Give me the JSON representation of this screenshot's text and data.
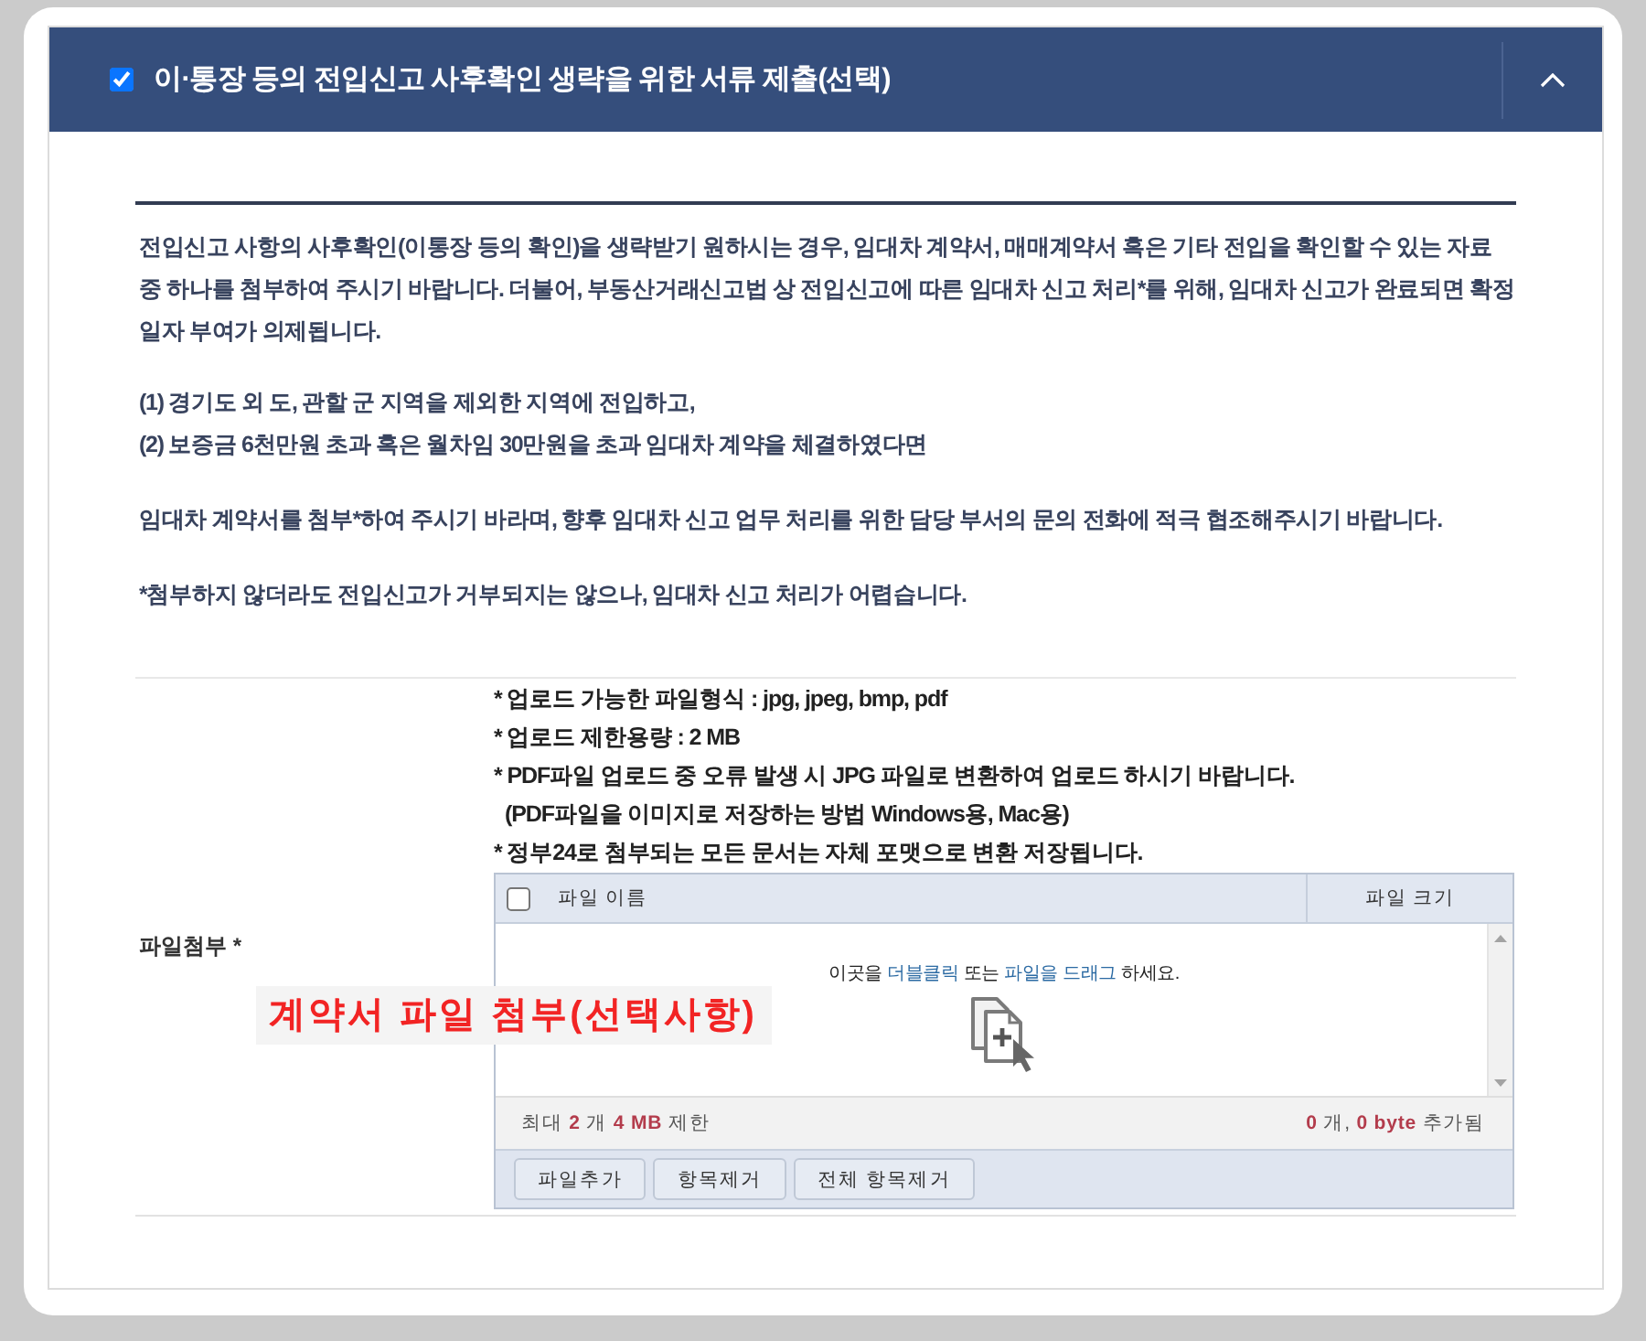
{
  "section": {
    "title": "이·통장 등의 전입신고 사후확인 생략을 위한 서류 제출(선택)",
    "checked": true,
    "expanded": true
  },
  "notice": {
    "paragraphs": [
      {
        "lines": [
          "전입신고 사항의 사후확인(이통장 등의 확인)을 생략받기 원하시는 경우, 임대차 계약서, 매매계약서 혹은 기타 전입을 확인할 수 있는 자료 중 하나를 첨부하여 주시기 바랍니다. 더불어, 부동산거래신고법 상 전입신고에 따른 임대차 신고 처리*를 위해, 임대차 신고가 완료되면 확정일자 부여가 의제됩니다."
        ]
      },
      {
        "lines": [
          "(1) 경기도 외 도, 관할 군 지역을 제외한 지역에 전입하고,",
          "(2) 보증금 6천만원 초과 혹은 월차임 30만원을 초과 임대차 계약을 체결하였다면"
        ]
      },
      {
        "lines": [
          "임대차 계약서를 첨부*하여 주시기 바라며, 향후 임대차 신고 업무 처리를 위한 담당 부서의 문의 전화에 적극 협조해주시기 바랍니다."
        ]
      },
      {
        "lines": [
          "*첨부하지 않더라도 전입신고가 거부되지는 않으나, 임대차 신고 처리가 어렵습니다."
        ]
      }
    ]
  },
  "attachment": {
    "label": "파일첨부 *",
    "notes": [
      {
        "text": "* 업로드 가능한 파일형식 : jpg, jpeg, bmp, pdf",
        "kind": "bullet"
      },
      {
        "text": "* 업로드 제한용량 : 2 MB",
        "kind": "bullet"
      },
      {
        "text": "* PDF파일 업로드 중 오류 발생 시 JPG 파일로 변환하여 업로드 하시기 바랍니다.",
        "kind": "bullet"
      },
      {
        "text": "(PDF파일을 이미지로 저장하는 방법  Windows용, Mac용)",
        "kind": "sub"
      },
      {
        "text": "* 정부24로 첨부되는 모든 문서는 자체 포맷으로 변환 저장됩니다.",
        "kind": "bullet"
      }
    ],
    "uploader": {
      "select_all_checked": false,
      "columns": [
        "파일 이름",
        "파일 크기"
      ],
      "drop_hint": [
        {
          "text": "이곳을 ",
          "kind": "plain"
        },
        {
          "text": "더블클릭",
          "kind": "accent"
        },
        {
          "text": " 또는 ",
          "kind": "plain"
        },
        {
          "text": "파일을 드래그",
          "kind": "accent"
        },
        {
          "text": " 하세요.",
          "kind": "plain"
        }
      ],
      "limit": [
        {
          "text": "최대 ",
          "kind": "plain"
        },
        {
          "text": "2",
          "kind": "value"
        },
        {
          "text": " 개 ",
          "kind": "plain"
        },
        {
          "text": "4 MB",
          "kind": "value"
        },
        {
          "text": " 제한",
          "kind": "plain"
        }
      ],
      "added": [
        {
          "text": "0",
          "kind": "value"
        },
        {
          "text": " 개, ",
          "kind": "plain"
        },
        {
          "text": "0 byte",
          "kind": "value"
        },
        {
          "text": " 추가됨",
          "kind": "plain"
        }
      ],
      "buttons": [
        "파일추가",
        "항목제거",
        "전체 항목제거"
      ]
    }
  },
  "annotation": {
    "text": "계약서 파일 첨부(선택사항)"
  }
}
